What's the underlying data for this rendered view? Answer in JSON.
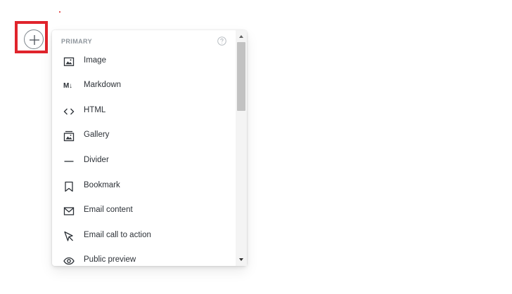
{
  "add_card_button": {
    "icon": "plus-icon"
  },
  "menu": {
    "section_title": "PRIMARY",
    "help_icon": "question-circle-icon",
    "items": [
      {
        "label": "Image",
        "icon": "image-icon"
      },
      {
        "label": "Markdown",
        "icon": "markdown-icon",
        "glyph": "M↓"
      },
      {
        "label": "HTML",
        "icon": "code-icon"
      },
      {
        "label": "Gallery",
        "icon": "gallery-icon"
      },
      {
        "label": "Divider",
        "icon": "divider-icon"
      },
      {
        "label": "Bookmark",
        "icon": "bookmark-icon"
      },
      {
        "label": "Email content",
        "icon": "email-icon"
      },
      {
        "label": "Email call to action",
        "icon": "cursor-arrow-icon"
      },
      {
        "label": "Public preview",
        "icon": "eye-icon"
      }
    ]
  },
  "colors": {
    "highlight": "#e0242c",
    "text": "#2c3137",
    "section_header": "#8e959c",
    "scroll_thumb": "#c2c2c2"
  }
}
